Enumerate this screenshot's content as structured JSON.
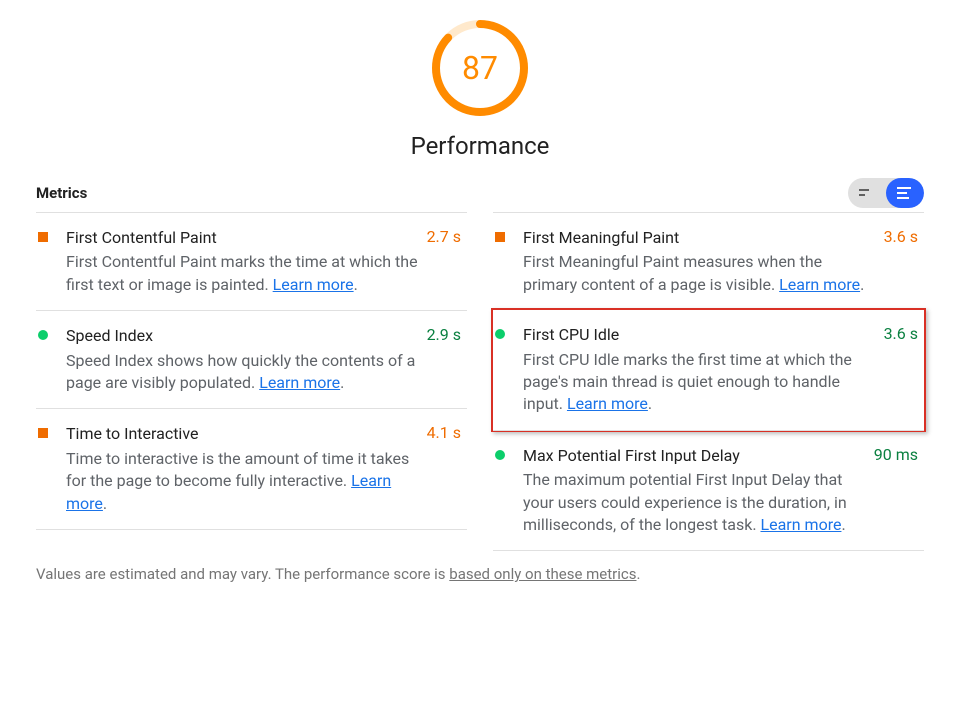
{
  "score": "87",
  "score_color": "#ff8b00",
  "score_pct": 87,
  "category_label": "Performance",
  "metrics_heading": "Metrics",
  "learn_more": "Learn more",
  "disclaimer_prefix": "Values are estimated and may vary. The performance score is ",
  "disclaimer_link": "based only on these metrics",
  "metrics": {
    "fcp": {
      "title": "First Contentful Paint",
      "desc": "First Contentful Paint marks the time at which the first text or image is painted. ",
      "value": "2.7 s"
    },
    "fmp": {
      "title": "First Meaningful Paint",
      "desc": "First Meaningful Paint measures when the primary content of a page is visible. ",
      "value": "3.6 s"
    },
    "si": {
      "title": "Speed Index",
      "desc": "Speed Index shows how quickly the contents of a page are visibly populated. ",
      "value": "2.9 s"
    },
    "fci": {
      "title": "First CPU Idle",
      "desc": "First CPU Idle marks the first time at which the page's main thread is quiet enough to handle input. ",
      "value": "3.6 s"
    },
    "tti": {
      "title": "Time to Interactive",
      "desc": "Time to interactive is the amount of time it takes for the page to become fully interactive. ",
      "value": "4.1 s"
    },
    "mpfid": {
      "title": "Max Potential First Input Delay",
      "desc": "The maximum potential First Input Delay that your users could experience is the duration, in milliseconds, of the longest task. ",
      "value": "90 ms"
    }
  }
}
